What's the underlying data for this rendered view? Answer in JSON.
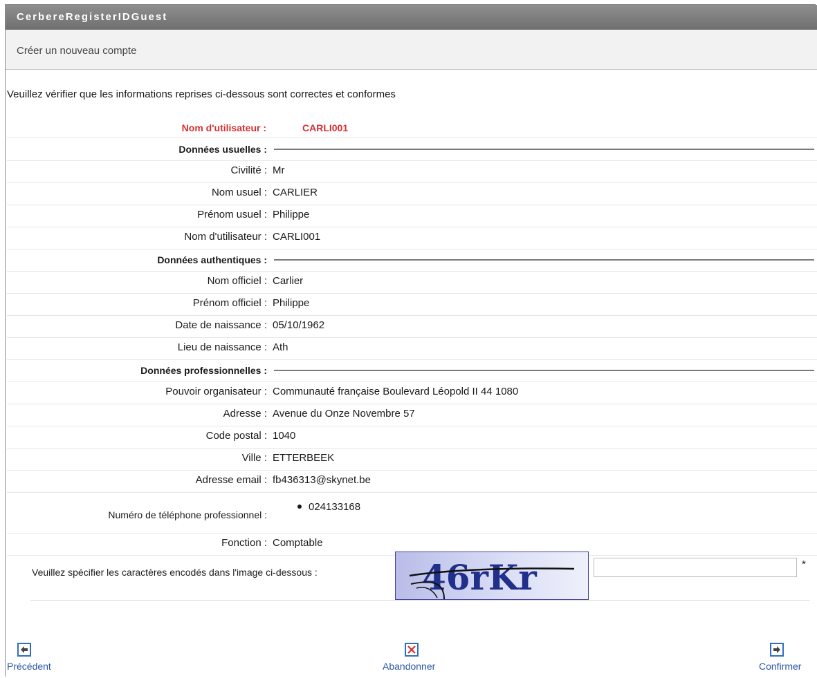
{
  "window": {
    "title": "CerbereRegisterIDGuest"
  },
  "page": {
    "subtitle": "Créer un nouveau compte",
    "intro": "Veuillez vérifier que les informations reprises ci-dessous sont correctes et conformes",
    "username_label": "Nom d'utilisateur :",
    "username_value": "CARLI001"
  },
  "sections": [
    {
      "title": "Données usuelles :",
      "fields": [
        {
          "label": "Civilité :",
          "value": "Mr"
        },
        {
          "label": "Nom usuel :",
          "value": "CARLIER"
        },
        {
          "label": "Prénom usuel :",
          "value": "Philippe"
        },
        {
          "label": "Nom d'utilisateur :",
          "value": "CARLI001"
        }
      ]
    },
    {
      "title": "Données authentiques :",
      "fields": [
        {
          "label": "Nom officiel :",
          "value": "Carlier"
        },
        {
          "label": "Prénom officiel :",
          "value": "Philippe"
        },
        {
          "label": "Date de naissance :",
          "value": "05/10/1962"
        },
        {
          "label": "Lieu de naissance :",
          "value": "Ath"
        }
      ]
    },
    {
      "title": "Données professionnelles :",
      "fields": [
        {
          "label": "Pouvoir organisateur :",
          "value": "Communauté française Boulevard Léopold II 44 1080"
        },
        {
          "label": "Adresse :",
          "value": "Avenue du Onze Novembre 57"
        },
        {
          "label": "Code postal :",
          "value": "1040"
        },
        {
          "label": "Ville :",
          "value": "ETTERBEEK"
        },
        {
          "label": "Adresse email :",
          "value": "fb436313@skynet.be"
        }
      ],
      "phone": {
        "label": "Numéro de téléphone professionnel :",
        "value": "024133168"
      },
      "function": {
        "label": "Fonction :",
        "value": "Comptable"
      }
    }
  ],
  "captcha": {
    "label": "Veuillez spécifier les caractères encodés dans l'image ci-dessous :",
    "image_text": "46rKr",
    "input_value": "",
    "required_mark": "*"
  },
  "buttons": {
    "previous": "Précédent",
    "abort": "Abandonner",
    "confirm": "Confirmer"
  },
  "icons": {
    "previous": "arrow-left-icon",
    "abort": "close-icon",
    "confirm": "arrow-right-icon"
  },
  "colors": {
    "accent": "#2f6fbf",
    "highlight": "#d62f2f",
    "titlebar": "#7f7f7f"
  }
}
